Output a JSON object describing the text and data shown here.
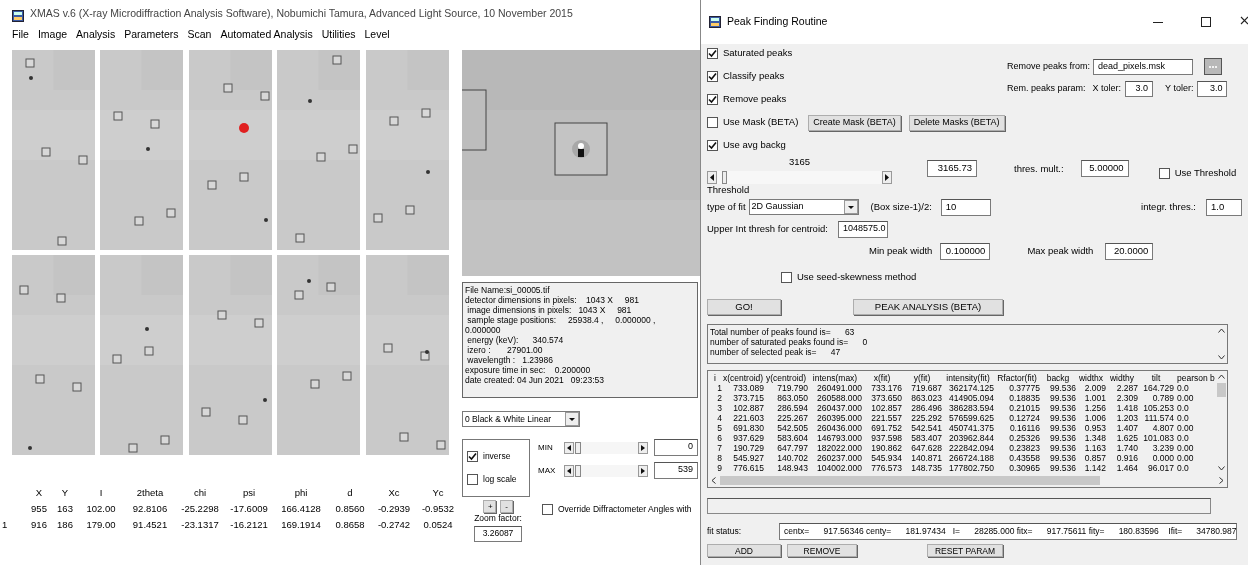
{
  "main_window": {
    "title": "XMAS v.6 (X-ray Microdiffraction Analysis Software), Nobumichi Tamura, Advanced Light Source, 10 November 2015",
    "menu": [
      "File",
      "Image",
      "Analysis",
      "Parameters",
      "Scan",
      "Automated Analysis",
      "Utilities",
      "Level"
    ],
    "file_info": [
      "File Name:si_00005.tif",
      "detector dimensions in pixels:    1043 X     981",
      " image dimensions in pixels:   1043 X     981",
      " sample stage positions:     25938.4 ,     0.000000 ,",
      "0.000000",
      " energy (keV):      340.574",
      " izero :       27901.00",
      " wavelength :   1.23986",
      "exposure time in sec:    0.200000",
      "date created: 04 Jun 2021   09:23:53"
    ],
    "colormap": "0 Black & White Linear",
    "display_options": [
      {
        "label": "inverse",
        "checked": true
      },
      {
        "label": "log scale",
        "checked": false
      }
    ],
    "ranges": [
      {
        "label": "MIN",
        "level": 0.02,
        "value": "0"
      },
      {
        "label": "MAX",
        "level": 0.02,
        "value": "539"
      }
    ],
    "zoom_buttons": [
      "+",
      "-"
    ],
    "zoom_label": "Zoom factor:",
    "zoom_value": "3.26087",
    "override": {
      "label": "Override Diffractometer Angles with",
      "checked": false
    },
    "peak_table": {
      "columns": [
        "X",
        "Y",
        "I",
        "2theta",
        "chi",
        "psi",
        "phi",
        "d",
        "Xc",
        "Yc"
      ],
      "rows": [
        {
          "cells": [
            "955",
            "163",
            "102.00",
            "92.8106",
            "-25.2298",
            "-17.6009",
            "166.4128",
            "0.8560",
            "-0.2939",
            "-0.9532"
          ]
        },
        {
          "index": "1",
          "cells": [
            "916",
            "186",
            "179.00",
            "91.4521",
            "-23.1317",
            "-16.2121",
            "169.1914",
            "0.8658",
            "-0.2742",
            "0.0524"
          ]
        }
      ]
    }
  },
  "peak_window": {
    "title": "Peak Finding Routine",
    "options": [
      {
        "label": "Saturated peaks",
        "checked": true
      },
      {
        "label": "Classify peaks",
        "checked": true
      },
      {
        "label": "Remove peaks",
        "checked": true
      },
      {
        "label": "Use Mask (BETA)",
        "checked": false
      },
      {
        "label": "Use avg backg",
        "checked": true
      }
    ],
    "mask_buttons": [
      "Create Mask (BETA)",
      "Delete Masks (BETA)"
    ],
    "remove_from": {
      "label": "Remove peaks from:",
      "value": "dead_pixels.msk"
    },
    "rem_params": {
      "label": "Rem. peaks param:",
      "xtoler_label": "X toler:",
      "xtoler": "3.0",
      "ytoler_label": "Y toler:",
      "ytoler": "3.0"
    },
    "threshold": {
      "reading": "3165",
      "level": 0.03,
      "label": "Threshold",
      "value": "3165.73"
    },
    "thres_mult": {
      "label": "thres. mult.:",
      "value": "5.00000"
    },
    "use_threshold": {
      "label": "Use Threshold",
      "checked": false
    },
    "fit_type": {
      "label": "type of fit",
      "value": "2D Gaussian"
    },
    "box_size": {
      "label": "(Box size-1)/2:",
      "value": "10"
    },
    "integr": {
      "label": "integr. thres.:",
      "value": "1.0"
    },
    "upper_int": {
      "label": "Upper Int thresh for centroid:",
      "value": "1048575.0"
    },
    "min_peak": {
      "label": "Min peak width",
      "value": "0.100000"
    },
    "max_peak": {
      "label": "Max peak width",
      "value": "20.0000"
    },
    "seed_skewness": {
      "label": "Use seed-skewness method",
      "checked": false
    },
    "go_button": "GO!",
    "analysis_button": "PEAK ANALYSIS (BETA)",
    "summary": [
      "Total number of peaks found is=      63",
      "number of saturated peaks found is=      0",
      "number of selected peak is=      47"
    ],
    "results": {
      "columns": [
        "i",
        "x(centroid)",
        "y(centroid)",
        "intens(max)",
        "x(fit)",
        "y(fit)",
        "intensity(fit)",
        "Rfactor(fit)",
        "backg",
        "widthx",
        "widthy",
        "tilt",
        "pearson b"
      ],
      "rows": [
        [
          "1",
          "733.089",
          "719.790",
          "260491.000",
          "733.176",
          "719.687",
          "362174.125",
          "0.37775",
          "99.536",
          "2.009",
          "2.287",
          "164.729",
          "0.0"
        ],
        [
          "2",
          "373.715",
          "863.050",
          "260588.000",
          "373.650",
          "863.023",
          "414905.094",
          "0.18835",
          "99.536",
          "1.001",
          "2.309",
          "0.789",
          "0.00"
        ],
        [
          "3",
          "102.887",
          "286.594",
          "260437.000",
          "102.857",
          "286.496",
          "386283.594",
          "0.21015",
          "99.536",
          "1.256",
          "1.418",
          "105.253",
          "0.0"
        ],
        [
          "4",
          "221.603",
          "225.267",
          "260395.000",
          "221.557",
          "225.292",
          "576599.625",
          "0.12724",
          "99.536",
          "1.006",
          "1.203",
          "111.574",
          "0.0"
        ],
        [
          "5",
          "691.830",
          "542.505",
          "260436.000",
          "691.752",
          "542.541",
          "450741.375",
          "0.16116",
          "99.536",
          "0.953",
          "1.407",
          "4.807",
          "0.00"
        ],
        [
          "6",
          "937.629",
          "583.604",
          "146793.000",
          "937.598",
          "583.407",
          "203962.844",
          "0.25326",
          "99.536",
          "1.348",
          "1.625",
          "101.083",
          "0.0"
        ],
        [
          "7",
          "190.729",
          "647.797",
          "182022.000",
          "190.862",
          "647.628",
          "222842.094",
          "0.23823",
          "99.536",
          "1.163",
          "1.740",
          "3.239",
          "0.00"
        ],
        [
          "8",
          "545.927",
          "140.702",
          "260237.000",
          "545.934",
          "140.871",
          "266724.188",
          "0.43558",
          "99.536",
          "0.857",
          "0.916",
          "0.000",
          "0.00"
        ],
        [
          "9",
          "776.615",
          "148.943",
          "104002.000",
          "776.573",
          "148.735",
          "177802.750",
          "0.30965",
          "99.536",
          "1.142",
          "1.464",
          "96.017",
          "0.0"
        ]
      ]
    },
    "fit_status": {
      "label": "fit status:",
      "value": "centx=      917.56346 centy=      181.97434   I=      28285.000 fitx=      917.75611 fity=      180.83596    Ifit=      34780.987"
    },
    "bottom_buttons": [
      "ADD",
      "REMOVE",
      "RESET PARAM"
    ]
  }
}
